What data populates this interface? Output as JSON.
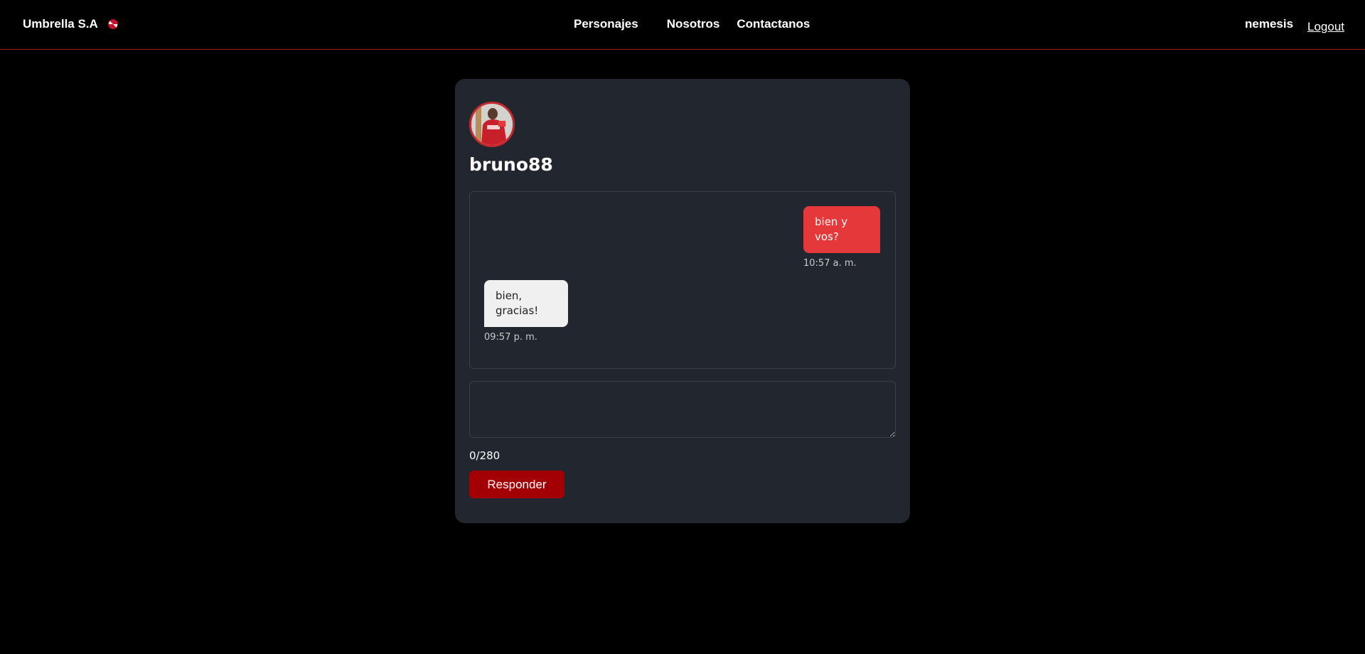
{
  "navbar": {
    "brand": "Umbrella S.A",
    "links": [
      "Personajes",
      "Nosotros",
      "Contactanos"
    ],
    "username": "nemesis",
    "logout": "Logout",
    "accent_color": "#b3141a"
  },
  "profile": {
    "name": "bruno88",
    "avatar_icon": "profile-photo"
  },
  "messages": [
    {
      "direction": "sent",
      "text": "bien y vos?",
      "time": "10:57 a. m.",
      "color": "#e5383b"
    },
    {
      "direction": "received",
      "text": "bien, gracias!",
      "time": "09:57 p. m.",
      "color": "#f0f0f0"
    }
  ],
  "reply": {
    "value": "",
    "char_count": "0/280",
    "button_label": "Responder",
    "button_color": "#a30005"
  },
  "colors": {
    "background": "#000000",
    "card": "#22262f"
  }
}
